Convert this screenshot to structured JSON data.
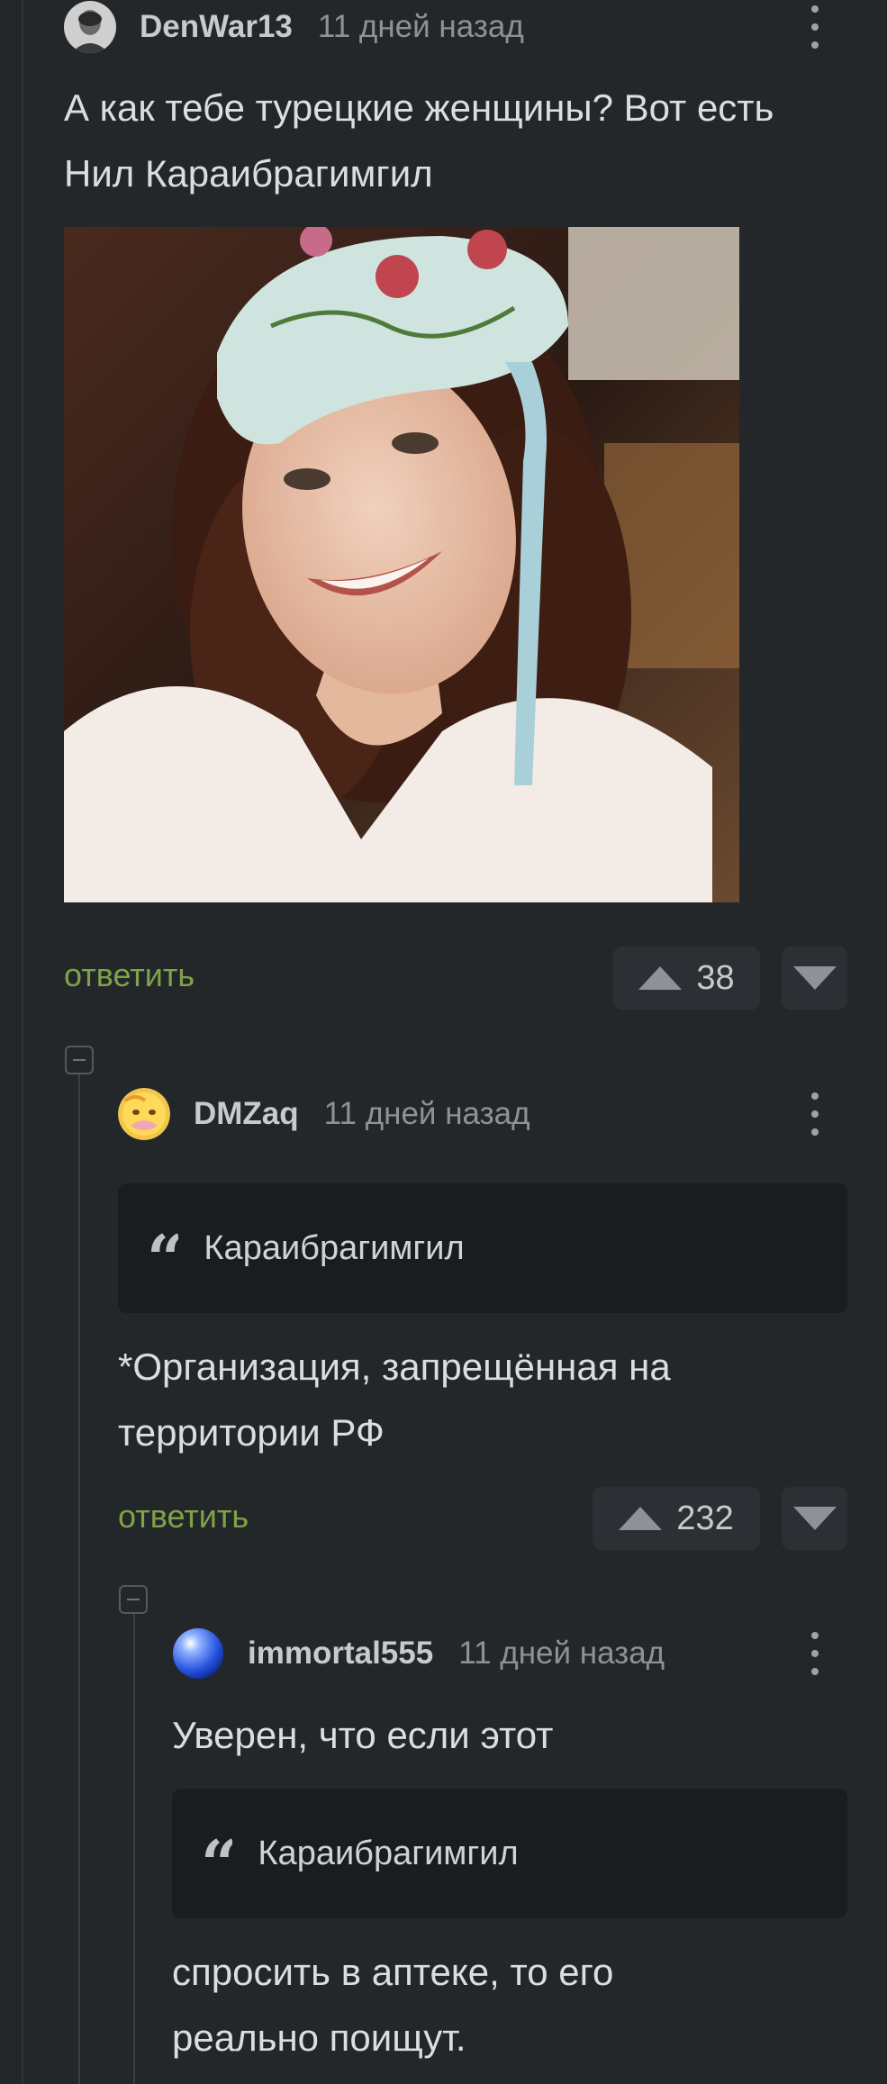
{
  "comments": [
    {
      "username": "DenWar13",
      "time": "11 дней назад",
      "text": "А как тебе турецкие женщины? Вот есть Нил Караибрагимгил",
      "reply_label": "ответить",
      "votes": "38",
      "avatar_icon": "user-photo-avatar",
      "image_alt": "photo-woman-in-headscarf"
    },
    {
      "username": "DMZaq",
      "time": "11 дней назад",
      "quote": "Караибрагимгил",
      "text": "*Организация, запрещённая на территории РФ",
      "reply_label": "ответить",
      "votes": "232",
      "avatar_icon": "emoji-avatar"
    },
    {
      "username": "immortal555",
      "time": "11 дней назад",
      "text_before": "Уверен, что если этот",
      "quote": "Караибрагимгил",
      "text_after": "спросить в аптеке, то его реально поищут.",
      "avatar_icon": "blue-sphere-avatar"
    }
  ],
  "colors": {
    "background": "#24272a",
    "reply_link": "#7fa24a",
    "quote_bg": "#1a1c1e",
    "vote_bg": "#2c3034"
  }
}
